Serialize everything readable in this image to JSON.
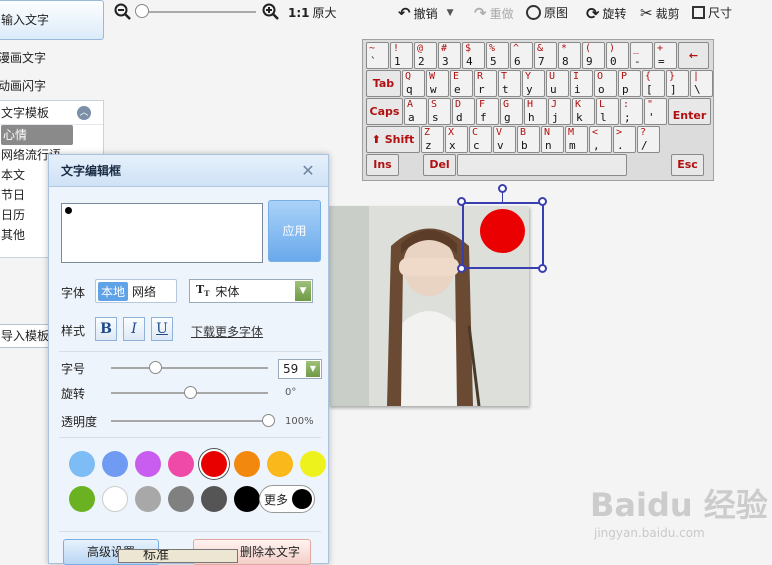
{
  "sidebar": {
    "input_text": "输入文字",
    "links": [
      "漫画文字",
      "动画闪字"
    ],
    "template_title": "文字模板",
    "template_items": [
      "心情",
      "网络流行语",
      "本文",
      "节日",
      "日历",
      "其他"
    ],
    "import_label": "导入模板"
  },
  "toolbar": {
    "ratio_label": "1:1",
    "original_size": "原大",
    "undo": "撤销",
    "redo": "重做",
    "original_image": "原图",
    "rotate": "旋转",
    "crop": "裁剪",
    "size": "尺寸"
  },
  "keyboard": {
    "row1": [
      [
        "~",
        "`"
      ],
      [
        "!",
        "1"
      ],
      [
        "@",
        "2"
      ],
      [
        "#",
        "3"
      ],
      [
        "$",
        "4"
      ],
      [
        "%",
        "5"
      ],
      [
        "^",
        "6"
      ],
      [
        "&",
        "7"
      ],
      [
        "*",
        "8"
      ],
      [
        "(",
        "9"
      ],
      [
        ")",
        "0"
      ],
      [
        "_",
        "-"
      ],
      [
        "+",
        "="
      ]
    ],
    "row1_end": "←",
    "tab": "Tab",
    "row2": [
      [
        "Q",
        "q"
      ],
      [
        "W",
        "w"
      ],
      [
        "E",
        "e"
      ],
      [
        "R",
        "r"
      ],
      [
        "T",
        "t"
      ],
      [
        "Y",
        "y"
      ],
      [
        "U",
        "u"
      ],
      [
        "I",
        "i"
      ],
      [
        "O",
        "o"
      ],
      [
        "P",
        "p"
      ],
      [
        "{",
        "["
      ],
      [
        "}",
        "]"
      ],
      [
        "|",
        "\\"
      ]
    ],
    "caps": "Caps",
    "row3": [
      [
        "A",
        "a"
      ],
      [
        "S",
        "s"
      ],
      [
        "D",
        "d"
      ],
      [
        "F",
        "f"
      ],
      [
        "G",
        "g"
      ],
      [
        "H",
        "h"
      ],
      [
        "J",
        "j"
      ],
      [
        "K",
        "k"
      ],
      [
        "L",
        "l"
      ],
      [
        ":",
        ";"
      ],
      [
        "\"",
        "'"
      ]
    ],
    "enter": "Enter",
    "shift": "Shift",
    "row4": [
      [
        "Z",
        "z"
      ],
      [
        "X",
        "x"
      ],
      [
        "C",
        "c"
      ],
      [
        "V",
        "v"
      ],
      [
        "B",
        "b"
      ],
      [
        "N",
        "n"
      ],
      [
        "M",
        "m"
      ],
      [
        "<",
        ","
      ],
      [
        ">",
        "."
      ],
      [
        "?",
        "/"
      ]
    ],
    "ins": "Ins",
    "del": "Del",
    "esc": "Esc"
  },
  "dialog": {
    "title": "文字编辑框",
    "apply": "应用",
    "font_label": "字体",
    "font_local": "本地",
    "font_network": "网络",
    "font_value": "宋体",
    "style_label": "样式",
    "bold": "B",
    "italic": "I",
    "underline": "U",
    "more_fonts": "下载更多字体",
    "size_label": "字号",
    "size_value": "59",
    "rotate_label": "旋转",
    "rotate_value": "0°",
    "opacity_label": "透明度",
    "opacity_value": "100%",
    "more_colors": "更多",
    "advanced": "高级设置",
    "delete_text": "删除本文字",
    "colors_row1": [
      "#7ebcf5",
      "#6f9cf2",
      "#c85df0",
      "#f04aa8",
      "#e80000",
      "#f3880f",
      "#fbb81a",
      "#eef21c"
    ],
    "colors_row2": [
      "#6ab221",
      "#ffffff",
      "#a8a8a8",
      "#808080",
      "#555555",
      "#000000"
    ],
    "selected_color": "#e80000",
    "size_slider": 0.28,
    "rotate_slider": 0.5,
    "opacity_slider": 1.0
  },
  "popup_text": "标准",
  "watermark": {
    "logo": "Baidu 经验",
    "url": "jingyan.baidu.com"
  }
}
